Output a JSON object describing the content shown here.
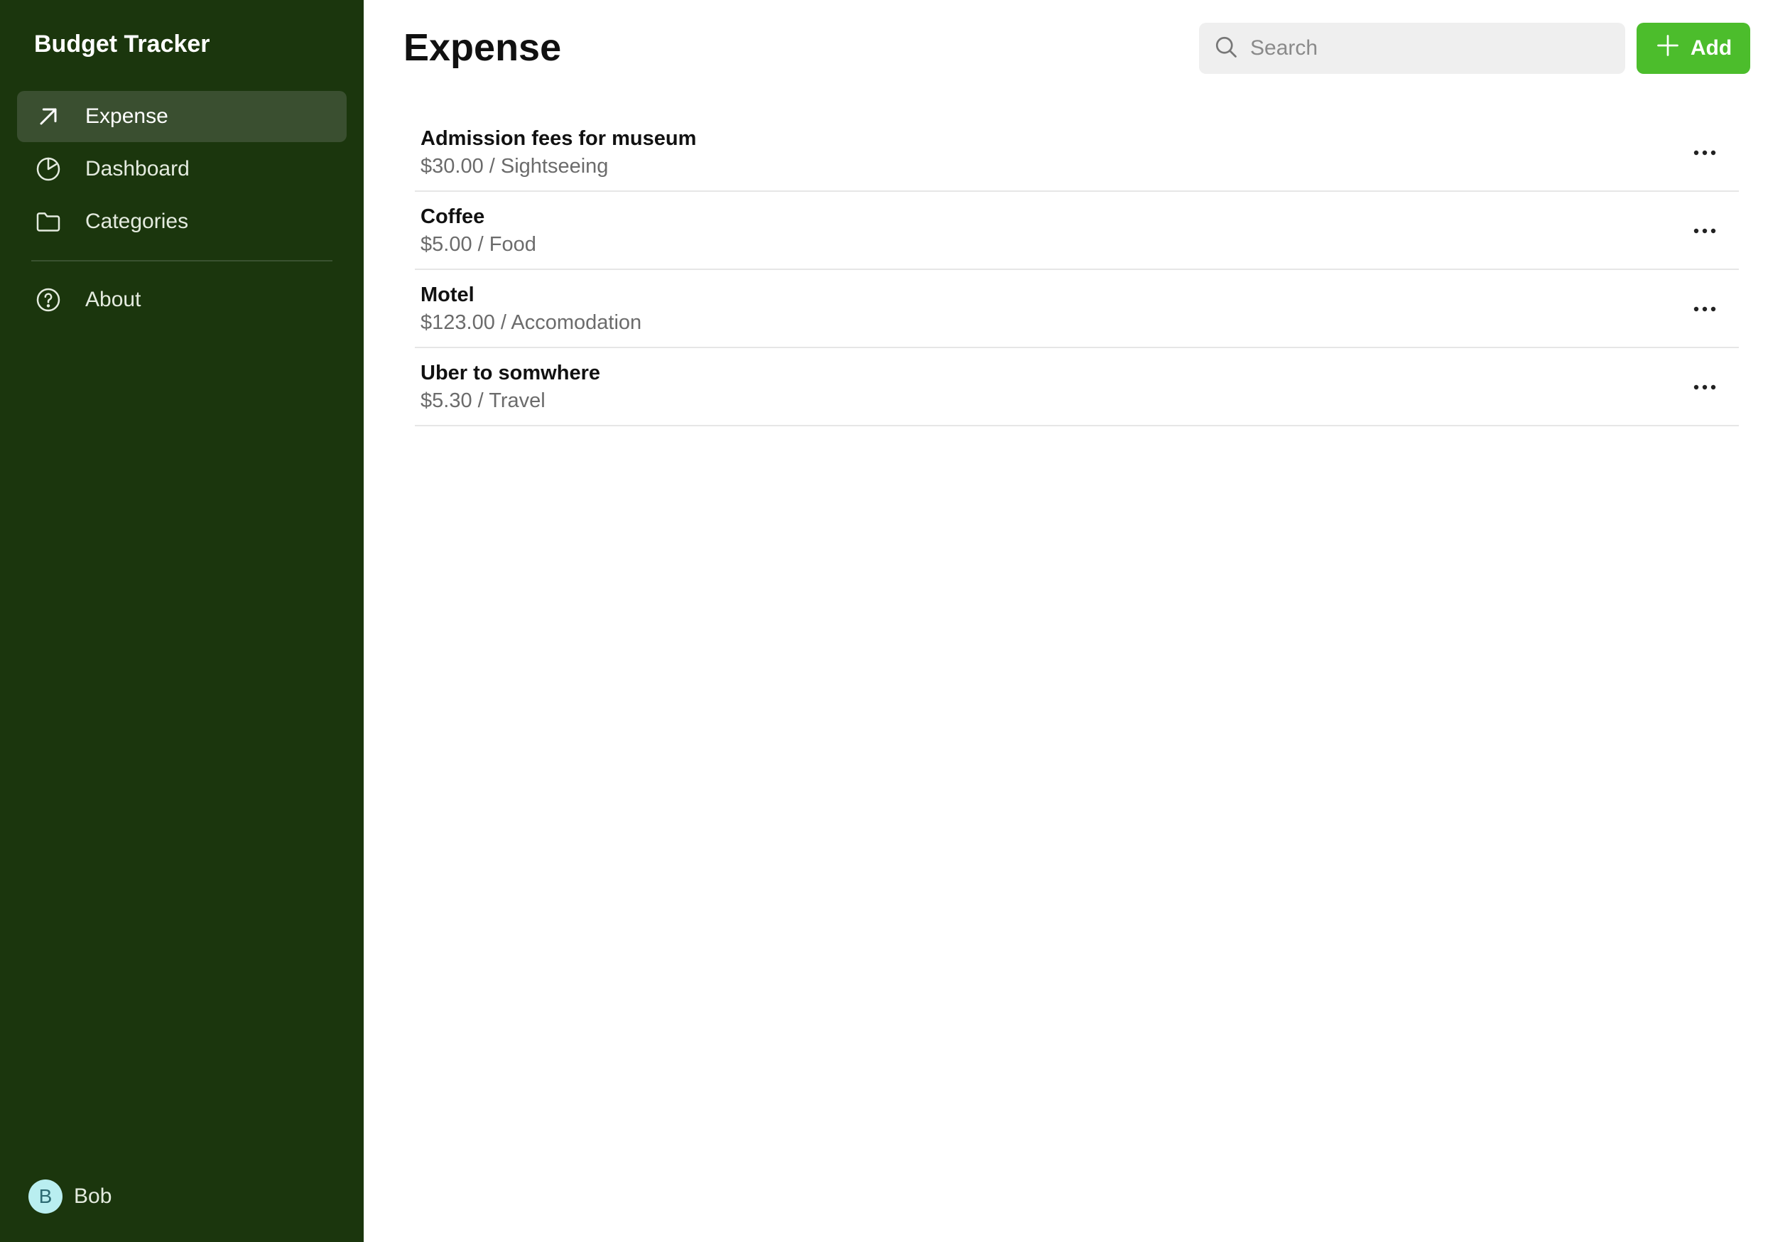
{
  "sidebar": {
    "title": "Budget Tracker",
    "items": [
      {
        "label": "Expense",
        "icon": "arrow-up-right-icon",
        "active": true
      },
      {
        "label": "Dashboard",
        "icon": "pie-chart-icon",
        "active": false
      },
      {
        "label": "Categories",
        "icon": "folder-icon",
        "active": false
      }
    ],
    "secondary_items": [
      {
        "label": "About",
        "icon": "help-circle-icon"
      }
    ],
    "user": {
      "initial": "B",
      "name": "Bob"
    }
  },
  "header": {
    "title": "Expense",
    "search_placeholder": "Search",
    "add_label": "Add"
  },
  "expenses": [
    {
      "title": "Admission fees for museum",
      "detail": "$30.00 / Sightseeing"
    },
    {
      "title": "Coffee",
      "detail": "$5.00 / Food"
    },
    {
      "title": "Motel",
      "detail": "$123.00 / Accomodation"
    },
    {
      "title": "Uber to somwhere",
      "detail": "$5.30 / Travel"
    }
  ],
  "colors": {
    "sidebar_bg": "#1b360d",
    "active_item_bg": "#3a4f30",
    "accent": "#4cbd2c",
    "avatar_bg": "#b9eef0"
  }
}
